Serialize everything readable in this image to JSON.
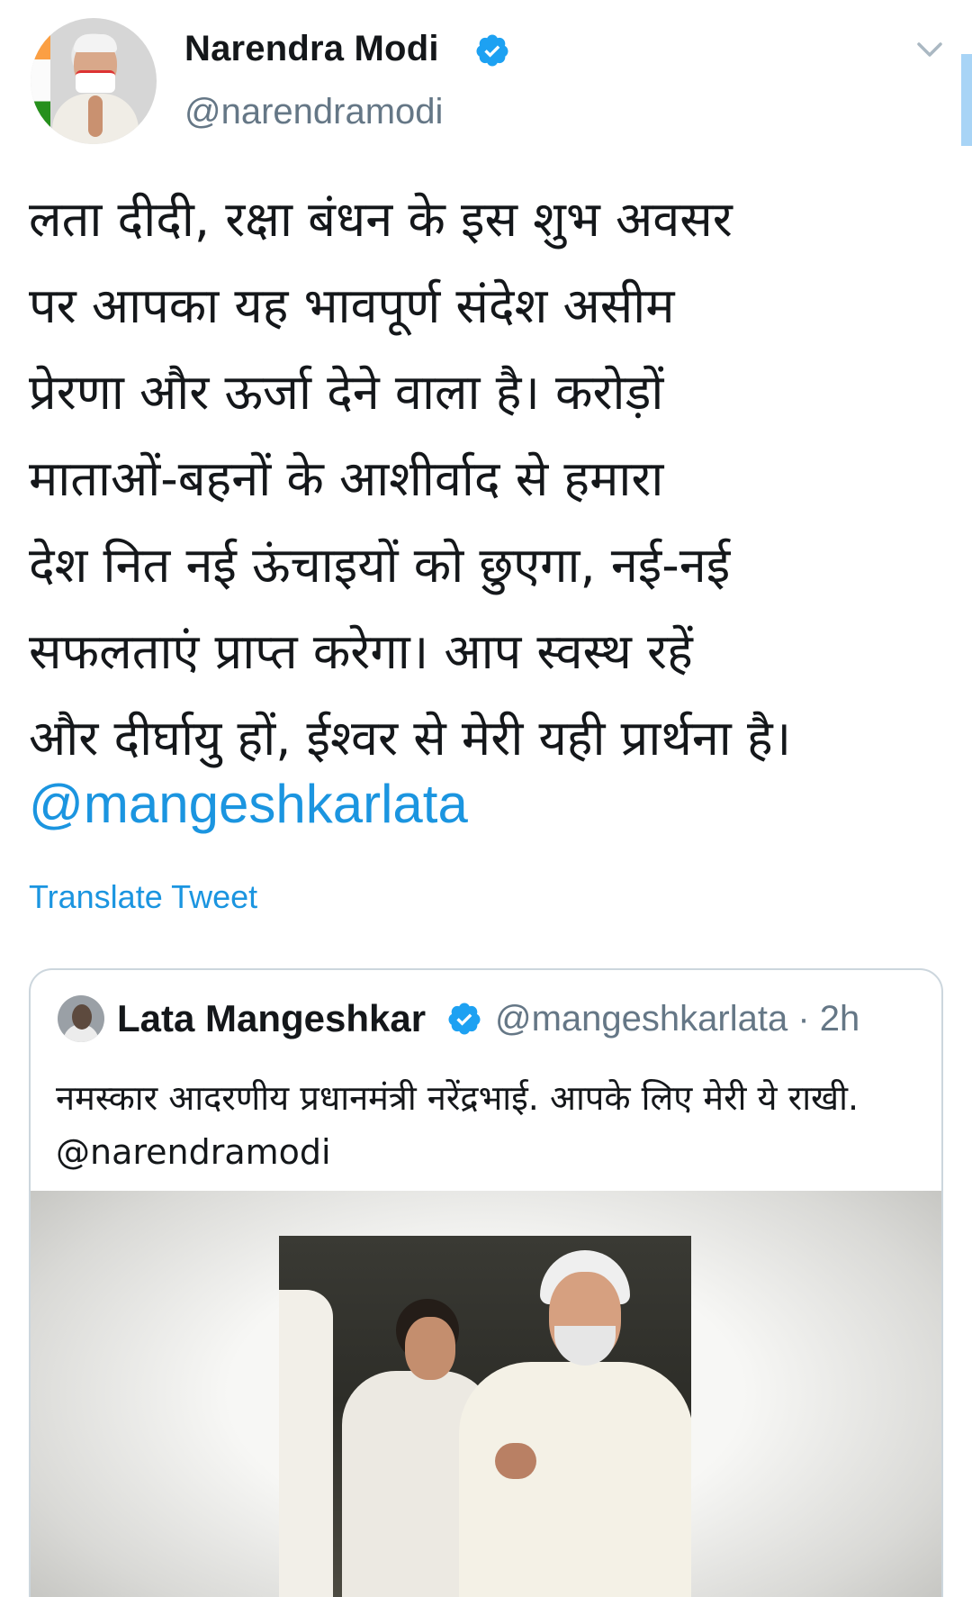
{
  "tweet": {
    "author_name": "Narendra Modi",
    "author_handle": "@narendramodi",
    "avatar_icon": "profile-avatar",
    "verified_icon": "verified-badge-icon",
    "menu_icon": "chevron-down-icon",
    "text": "लता दीदी, रक्षा बंधन के इस शुभ अवसर\nपर आपका यह भावपूर्ण संदेश असीम\nप्रेरणा और ऊर्जा देने वाला है। करोड़ों\nमाताओं-बहनों के आशीर्वाद से हमारा\nदेश नित नई ऊंचाइयों को छुएगा, नई-नई\nसफलताएं प्राप्त करेगा। आप स्वस्थ रहें\nऔर दीर्घायु हों, ईश्वर से मेरी यही प्रार्थना है।",
    "mention": "@mangeshkarlata",
    "translate_label": "Translate Tweet"
  },
  "quoted_tweet": {
    "author_name": "Lata Mangeshkar",
    "author_handle": "@mangeshkarlata",
    "separator": "·",
    "time": "2h",
    "text": "नमस्कार आदरणीय प्रधानमंत्री नरेंद्रभाई. आपके लिए मेरी ये राखी. @narendramodi",
    "media_type": "video-thumbnail"
  },
  "colors": {
    "link": "#1b95e0",
    "text": "#14171a",
    "secondary": "#657786",
    "border": "#ccd6dd",
    "verified": "#1da1f2"
  }
}
